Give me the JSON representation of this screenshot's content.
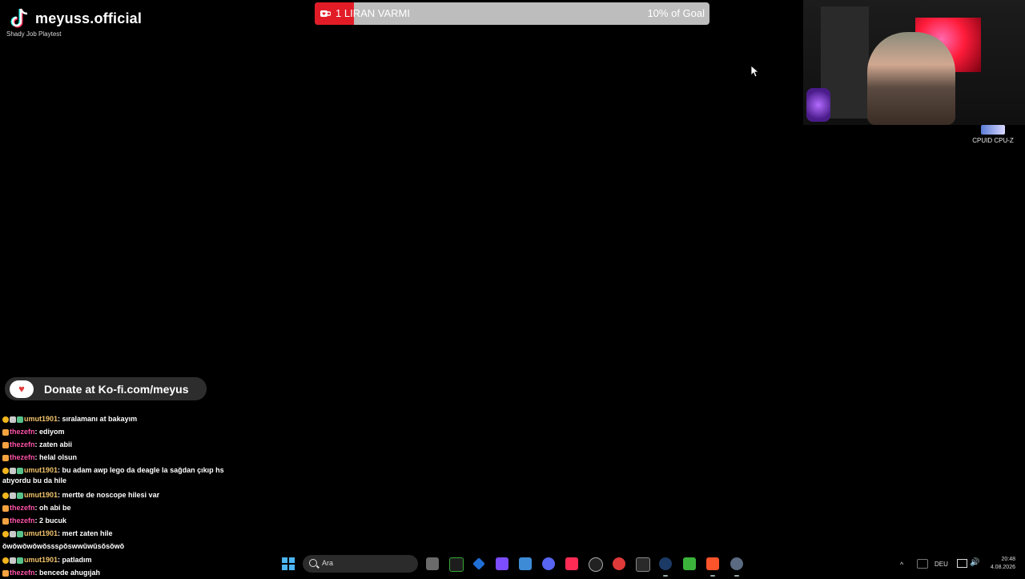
{
  "brand": {
    "name": "meyuss.official",
    "subtitle": "Shady Job Playtest"
  },
  "goal": {
    "label": "1 LIRAN VARMI",
    "progress_text": "10% of Goal",
    "progress": 0.1,
    "fill_color": "#e21c27",
    "track_color": "#bdbdbd"
  },
  "desktop_icon": {
    "label": "CPUID CPU-Z"
  },
  "kofi": {
    "label": "Donate at Ko-fi.com/meyus"
  },
  "chat": [
    {
      "user": "umut1901",
      "text": "sıralamanı at bakayım",
      "badges": [
        "gold",
        "grey",
        "green"
      ]
    },
    {
      "user": "thezefn",
      "text": "ediyom",
      "badges": [
        "orange"
      ]
    },
    {
      "user": "thezefn",
      "text": "zaten abii",
      "badges": [
        "orange"
      ]
    },
    {
      "user": "thezefn",
      "text": "helal olsun",
      "badges": [
        "orange"
      ]
    },
    {
      "user": "umut1901",
      "text": "bu adam awp lego da deagle la sağdan çıkıp hs atıyordu bu da hile",
      "badges": [
        "gold",
        "grey",
        "green"
      ]
    },
    {
      "user": "umut1901",
      "text": "mertte de noscope hilesi var",
      "badges": [
        "gold",
        "grey",
        "green"
      ]
    },
    {
      "user": "thezefn",
      "text": "oh abi be",
      "badges": [
        "orange"
      ]
    },
    {
      "user": "thezefn",
      "text": "2 bucuk",
      "badges": [
        "orange"
      ]
    },
    {
      "user": "umut1901",
      "text": "mert zaten hile",
      "badges": [
        "gold",
        "grey",
        "green"
      ]
    },
    {
      "user": "",
      "text": "ŏwŏwŏwŏwŏsssρŏswwŭwŭsŏsŏwŏ",
      "badges": []
    },
    {
      "user": "umut1901",
      "text": "patladım",
      "badges": [
        "gold",
        "grey",
        "green"
      ]
    },
    {
      "user": "thezefn",
      "text": "bencede ahugıjah",
      "badges": [
        "orange"
      ]
    }
  ],
  "taskbar": {
    "search_placeholder": "Ara",
    "apps": [
      "file-explorer",
      "terminal",
      "sourcetree",
      "app-grid",
      "edge-like",
      "discord",
      "tiktok",
      "obs",
      "media",
      "epic-games",
      "steam",
      "minecraft",
      "brave",
      "settings"
    ],
    "language": "DEU",
    "time": "20:48",
    "date": "4.08.2026"
  }
}
